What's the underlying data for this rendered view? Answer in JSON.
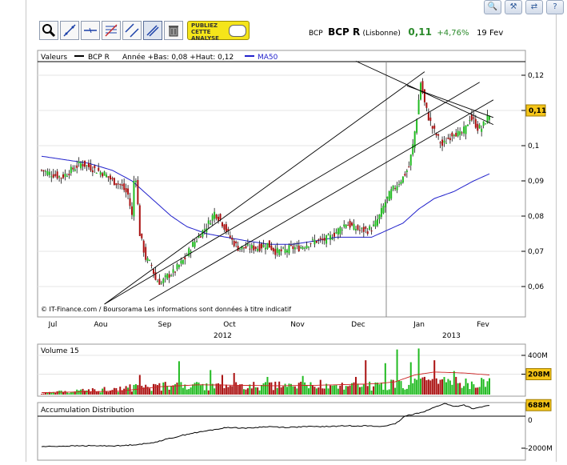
{
  "quote": {
    "ticker": "BCP",
    "name": "BCP R",
    "market": "(Lisbonne)",
    "price": "0,11",
    "change": "+4,76%",
    "date": "19 Fev"
  },
  "toolbar": {
    "publish_lines": [
      "PUBLIEZ",
      "CETTE",
      "ANALYSE"
    ]
  },
  "main_legend": {
    "label": "Valeurs",
    "series": "BCP R",
    "stats": "Année +Bas: 0,08 +Haut: 0,12",
    "ma": "MA50"
  },
  "credit": "© IT-Finance.com / Boursorama Les informations sont données à titre indicatif",
  "colors": {
    "up": "#22bb22",
    "down": "#aa1111",
    "ma": "#2222cc",
    "tag": "#f5c518",
    "volume_line": "#cc2222"
  },
  "chart_data": [
    {
      "type": "candlestick",
      "x_labels": [
        "Jul",
        "Aou",
        "Sep",
        "Oct",
        "Nov",
        "Dec",
        "Jan",
        "Fev"
      ],
      "year_labels": [
        "2012",
        "2013"
      ],
      "y_ticks": [
        "0,12",
        "0,11",
        "0,1",
        "0,09",
        "0,08",
        "0,07",
        "0,06"
      ],
      "ylim": [
        0.055,
        0.124
      ],
      "last_tag": "0,11",
      "close_path": [
        [
          0,
          0.093
        ],
        [
          5,
          0.092
        ],
        [
          10,
          0.091
        ],
        [
          15,
          0.093
        ],
        [
          20,
          0.095
        ],
        [
          24,
          0.094
        ],
        [
          28,
          0.093
        ],
        [
          32,
          0.092
        ],
        [
          36,
          0.09
        ],
        [
          40,
          0.089
        ],
        [
          44,
          0.086
        ],
        [
          46,
          0.08
        ],
        [
          47,
          0.09
        ],
        [
          48,
          0.091
        ],
        [
          50,
          0.075
        ],
        [
          53,
          0.068
        ],
        [
          56,
          0.066
        ],
        [
          58,
          0.062
        ],
        [
          61,
          0.061
        ],
        [
          64,
          0.063
        ],
        [
          67,
          0.064
        ],
        [
          70,
          0.066
        ],
        [
          73,
          0.068
        ],
        [
          77,
          0.072
        ],
        [
          81,
          0.075
        ],
        [
          85,
          0.078
        ],
        [
          88,
          0.081
        ],
        [
          91,
          0.079
        ],
        [
          94,
          0.076
        ],
        [
          97,
          0.073
        ],
        [
          100,
          0.071
        ],
        [
          105,
          0.071
        ],
        [
          110,
          0.071
        ],
        [
          115,
          0.072
        ],
        [
          119,
          0.07
        ],
        [
          123,
          0.07
        ],
        [
          127,
          0.071
        ],
        [
          131,
          0.071
        ],
        [
          135,
          0.072
        ],
        [
          139,
          0.073
        ],
        [
          143,
          0.073
        ],
        [
          147,
          0.074
        ],
        [
          151,
          0.076
        ],
        [
          155,
          0.078
        ],
        [
          158,
          0.077
        ],
        [
          162,
          0.076
        ],
        [
          166,
          0.076
        ],
        [
          169,
          0.077
        ],
        [
          172,
          0.08
        ],
        [
          175,
          0.084
        ],
        [
          178,
          0.087
        ],
        [
          181,
          0.089
        ],
        [
          184,
          0.091
        ],
        [
          187,
          0.094
        ],
        [
          189,
          0.1
        ],
        [
          191,
          0.108
        ],
        [
          193,
          0.118
        ],
        [
          195,
          0.112
        ],
        [
          197,
          0.108
        ],
        [
          199,
          0.105
        ],
        [
          201,
          0.103
        ],
        [
          204,
          0.1
        ],
        [
          207,
          0.102
        ],
        [
          210,
          0.104
        ],
        [
          213,
          0.103
        ],
        [
          216,
          0.105
        ],
        [
          218,
          0.108
        ],
        [
          220,
          0.107
        ],
        [
          222,
          0.105
        ],
        [
          224,
          0.105
        ],
        [
          226,
          0.107
        ],
        [
          228,
          0.109
        ]
      ],
      "ma50": [
        [
          0,
          0.097
        ],
        [
          12,
          0.096
        ],
        [
          24,
          0.095
        ],
        [
          36,
          0.093
        ],
        [
          46,
          0.09
        ],
        [
          54,
          0.086
        ],
        [
          60,
          0.083
        ],
        [
          66,
          0.08
        ],
        [
          74,
          0.077
        ],
        [
          84,
          0.075
        ],
        [
          94,
          0.074
        ],
        [
          104,
          0.073
        ],
        [
          116,
          0.072
        ],
        [
          128,
          0.072
        ],
        [
          140,
          0.073
        ],
        [
          150,
          0.074
        ],
        [
          160,
          0.074
        ],
        [
          168,
          0.074
        ],
        [
          176,
          0.076
        ],
        [
          184,
          0.078
        ],
        [
          192,
          0.082
        ],
        [
          200,
          0.085
        ],
        [
          210,
          0.087
        ],
        [
          220,
          0.09
        ],
        [
          228,
          0.092
        ]
      ],
      "trend_lines": [
        [
          [
            32,
            0.055
          ],
          [
            195,
            0.121
          ]
        ],
        [
          [
            32,
            0.055
          ],
          [
            223,
            0.118
          ]
        ],
        [
          [
            55,
            0.056
          ],
          [
            230,
            0.113
          ]
        ],
        [
          [
            160,
            0.124
          ],
          [
            230,
            0.106
          ]
        ],
        [
          [
            186,
            0.117
          ],
          [
            230,
            0.108
          ]
        ]
      ]
    },
    {
      "type": "bar",
      "title": "Volume 15",
      "y_ticks": [
        "400M",
        "208M"
      ],
      "ylim": [
        0,
        480
      ],
      "last_tag": "208M",
      "peaks": [
        [
          50,
          200
        ],
        [
          70,
          340
        ],
        [
          86,
          250
        ],
        [
          92,
          200
        ],
        [
          98,
          220
        ],
        [
          115,
          180
        ],
        [
          133,
          190
        ],
        [
          142,
          150
        ],
        [
          160,
          180
        ],
        [
          165,
          350
        ],
        [
          175,
          320
        ],
        [
          181,
          460
        ],
        [
          188,
          330
        ],
        [
          192,
          470
        ],
        [
          200,
          350
        ],
        [
          210,
          240
        ]
      ],
      "ma_line": [
        [
          0,
          20
        ],
        [
          40,
          35
        ],
        [
          60,
          80
        ],
        [
          80,
          100
        ],
        [
          100,
          95
        ],
        [
          120,
          90
        ],
        [
          140,
          95
        ],
        [
          160,
          105
        ],
        [
          170,
          110
        ],
        [
          180,
          130
        ],
        [
          190,
          200
        ],
        [
          200,
          230
        ],
        [
          215,
          220
        ],
        [
          228,
          200
        ]
      ]
    },
    {
      "type": "line",
      "title": "Accumulation Distribution",
      "y_ticks": [
        "0",
        "-2000M"
      ],
      "ylim": [
        -2200,
        1000
      ],
      "last_tag": "688M",
      "values": [
        [
          0,
          -1900
        ],
        [
          20,
          -1850
        ],
        [
          40,
          -1850
        ],
        [
          55,
          -1700
        ],
        [
          65,
          -1400
        ],
        [
          75,
          -1100
        ],
        [
          85,
          -900
        ],
        [
          95,
          -700
        ],
        [
          105,
          -750
        ],
        [
          115,
          -650
        ],
        [
          125,
          -700
        ],
        [
          135,
          -650
        ],
        [
          145,
          -650
        ],
        [
          155,
          -600
        ],
        [
          165,
          -600
        ],
        [
          172,
          -650
        ],
        [
          180,
          -500
        ],
        [
          185,
          0
        ],
        [
          190,
          150
        ],
        [
          195,
          300
        ],
        [
          200,
          550
        ],
        [
          205,
          800
        ],
        [
          210,
          600
        ],
        [
          215,
          700
        ],
        [
          220,
          450
        ],
        [
          228,
          688
        ]
      ]
    }
  ]
}
